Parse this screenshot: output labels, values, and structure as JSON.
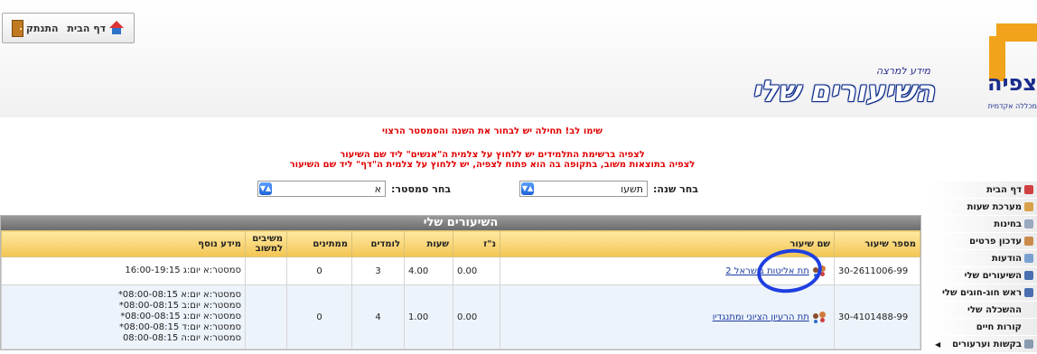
{
  "topbar": {
    "home_label": "דף הבית",
    "logout_label": "התנתק"
  },
  "header": {
    "tagline": "מידע למרצה",
    "title": "השיעורים שלי",
    "logo_text": "צפיה",
    "logo_sub": "מכללה אקדמית"
  },
  "notices": {
    "line1": "שימו לב! תחילה יש לבחור את השנה והסמסטר הרצוי",
    "line2": "לצפיה ברשימת התלמידים יש ללחוץ על צלמית ה\"אנשים\" ליד שם השיעור",
    "line3": "לצפיה בתוצאות משוב, בתקופה בה הוא פתוח לצפיה, יש ללחוץ על צלמית ה\"דף\" ליד שם השיעור"
  },
  "filters": {
    "year_label": "בחר שנה:",
    "year_value": "תשעו",
    "semester_label": "בחר סמסטר:",
    "semester_value": "א"
  },
  "sidebar": {
    "items": [
      {
        "label": "דף הבית",
        "icon": "home-icon",
        "color": "#d04040"
      },
      {
        "label": "מערכת שעות",
        "icon": "calendar-icon",
        "color": "#d9a24a"
      },
      {
        "label": "בחינות",
        "icon": "exam-icon",
        "color": "#9aa8c0"
      },
      {
        "label": "עדכון פרטים",
        "icon": "user-icon",
        "color": "#c98a4a"
      },
      {
        "label": "הודעות",
        "icon": "message-icon",
        "color": "#7aa0d0"
      },
      {
        "label": "השיעורים שלי",
        "icon": "people-icon",
        "color": "#4a6fb0"
      },
      {
        "label": "ראש חוג-חוגים שלי",
        "icon": "group-icon",
        "color": "#4a6fb0"
      },
      {
        "label": "ההשכלה שלי",
        "icon": "",
        "color": ""
      },
      {
        "label": "קורות חיים",
        "icon": "",
        "color": ""
      },
      {
        "label": "בקשות וערעורים",
        "icon": "request-icon",
        "color": "#8a9ab0"
      }
    ]
  },
  "grid": {
    "title": "השיעורים שלי",
    "headers": [
      "מספר שיעור",
      "שם שיעור",
      "נ\"ז",
      "שעות",
      "לומדים",
      "ממתינים",
      "משיבים למשוב",
      "מידע נוסף"
    ],
    "rows": [
      {
        "number": "30-2611006-99",
        "name": "תת אליטות בישראל 2",
        "credits": "0.00",
        "hours": "4.00",
        "students": "3",
        "waiting": "0",
        "responders": "",
        "schedule": [
          "סמסטר:א יום:ג 16:00-19:15"
        ]
      },
      {
        "number": "30-4101488-99",
        "name": "תת הרעיון הציוני ומתנגדיו",
        "credits": "0.00",
        "hours": "1.00",
        "students": "4",
        "waiting": "0",
        "responders": "",
        "schedule": [
          "סמסטר:א יום:א 08:00-08:15*",
          "סמסטר:א יום:ב 08:00-08:15*",
          "סמסטר:א יום:ג 08:00-08:15*",
          "סמסטר:א יום:ד 08:00-08:15*",
          "סמסטר:א יום:ה 08:00-08:15"
        ]
      }
    ]
  },
  "colors": {
    "notice": "#e10000",
    "title_outline": "#0d2b8a",
    "header_gold": "#f3c552",
    "annotation": "#1f3fe0"
  }
}
